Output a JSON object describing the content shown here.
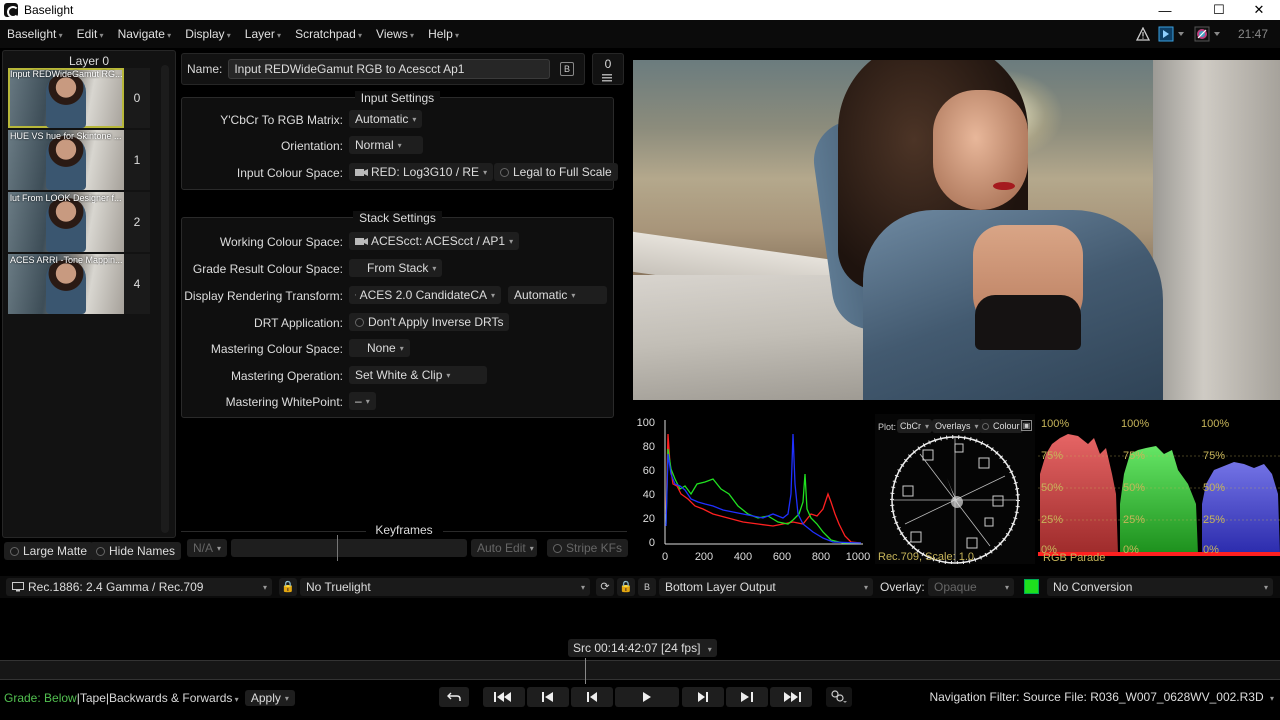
{
  "window": {
    "title": "Baselight",
    "minimize": "—",
    "maximize": "☐",
    "close": "✕"
  },
  "menubar": {
    "items": [
      "Baselight",
      "Edit",
      "Navigate",
      "Display",
      "Layer",
      "Scratchpad",
      "Views",
      "Help"
    ],
    "clock": "21:47"
  },
  "layers": {
    "header": "Layer 0",
    "items": [
      {
        "caption": "Input REDWideGamut RG...",
        "number": "0"
      },
      {
        "caption": "HUE VS hue for Skintone ...",
        "number": "1"
      },
      {
        "caption": "lut From LOOK Designer f...",
        "number": "2"
      },
      {
        "caption": "ACES ARRI -Tone Mappin...",
        "number": "4"
      }
    ],
    "large_matte": "Large Matte",
    "hide_names": "Hide Names"
  },
  "name_bar": {
    "label": "Name:",
    "value": "Input REDWideGamut RGB to Acescct Ap1",
    "b_label": "B",
    "layer_count": "0"
  },
  "input_settings": {
    "title": "Input Settings",
    "ycbcr_label": "Y'CbCr To RGB Matrix:",
    "ycbcr_value": "Automatic",
    "orientation_label": "Orientation:",
    "orientation_value": "Normal",
    "colour_space_label": "Input Colour Space:",
    "colour_space_value": "RED: Log3G10 / RE",
    "legal_to_full": "Legal to Full Scale"
  },
  "stack_settings": {
    "title": "Stack Settings",
    "working_label": "Working Colour Space:",
    "working_value": "ACEScct: ACEScct / AP1",
    "grade_result_label": "Grade Result Colour Space:",
    "grade_result_value": "From Stack",
    "drt_label": "Display Rendering Transform:",
    "drt_value": "ACES 2.0 CandidateCA",
    "drt_mode": "Automatic",
    "drt_app_label": "DRT Application:",
    "drt_app_value": "Don't Apply Inverse DRTs",
    "mastering_cs_label": "Mastering Colour Space:",
    "mastering_cs_value": "None",
    "mastering_op_label": "Mastering Operation:",
    "mastering_op_value": "Set White & Clip",
    "mastering_wp_label": "Mastering WhitePoint:",
    "mastering_wp_value": "–"
  },
  "keyframes": {
    "title": "Keyframes",
    "value": "N/A",
    "auto_edit": "Auto Edit",
    "stripe_kfs": "Stripe KFs"
  },
  "histogram": {
    "y_ticks": [
      "100",
      "80",
      "60",
      "40",
      "20",
      "0"
    ],
    "x_ticks": [
      "0",
      "200",
      "400",
      "600",
      "800",
      "1000"
    ]
  },
  "vectorscope": {
    "plot_label": "Plot:",
    "plot_value": "CbCr",
    "overlays": "Overlays",
    "colour": "Colour",
    "footer": "Rec.709, Scale: 1.0"
  },
  "parade": {
    "pct_100": "100%",
    "pct_75": "75%",
    "pct_50": "50%",
    "pct_25": "25%",
    "pct_0": "0%",
    "footer": "RGB Parade"
  },
  "viewbar": {
    "display": "Rec.1886: 2.4 Gamma / Rec.709",
    "truelight": "No Truelight",
    "output": "Bottom Layer Output",
    "overlay_label": "Overlay:",
    "overlay_value": "Opaque",
    "conversion": "No Conversion",
    "b_label": "B"
  },
  "timeline": {
    "timecode": "Src 00:14:42:07 [24 fps]"
  },
  "transport": {
    "grade_label": "Grade:",
    "grade_value": "Below",
    "tape": "Tape",
    "direction": "Backwards & Forwards",
    "apply": "Apply",
    "nav_filter": "Navigation Filter: Source File: R036_W007_0628WV_002.R3D"
  }
}
